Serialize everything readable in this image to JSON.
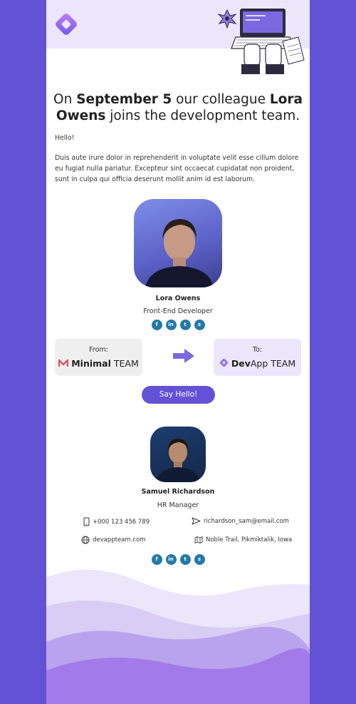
{
  "headline": {
    "p1": "On ",
    "date": "September 5",
    "p2": " our colleague ",
    "name": "Lora Owens",
    "p3": " joins the development team."
  },
  "greeting": "Hello!",
  "body_text": "Duis aute irure dolor in reprehenderit in voluptate velit esse cillum dolore eu fugiat nulla pariatur. Excepteur sint occaecat cupidatat non proident, sunt in culpa qui officia deserunt mollit anim id est laborum.",
  "new_member": {
    "name": "Lora Owens",
    "role": "Front-End Developer"
  },
  "socials": [
    {
      "icon": "facebook-icon",
      "glyph": "f"
    },
    {
      "icon": "linkedin-icon",
      "glyph": "in"
    },
    {
      "icon": "twitter-icon",
      "glyph": "t"
    },
    {
      "icon": "skype-icon",
      "glyph": "s"
    }
  ],
  "transfer": {
    "from_label": "From:",
    "from_team_bold": "Minimal",
    "from_team_rest": " TEAM",
    "to_label": "To:",
    "to_team_bold": "Dev",
    "to_team_rest": "App TEAM"
  },
  "cta": "Say Hello!",
  "hr": {
    "name": "Samuel Richardson",
    "role": "HR Manager",
    "phone": "+000 123 456 789",
    "email": "richardson_sam@email.com",
    "website": "devappteam.com",
    "address": "Noble Trail, Pikmiktalik, Iowa"
  },
  "colors": {
    "accent": "#6452d6",
    "header_bg": "#ece6fb",
    "social": "#2579a8"
  }
}
